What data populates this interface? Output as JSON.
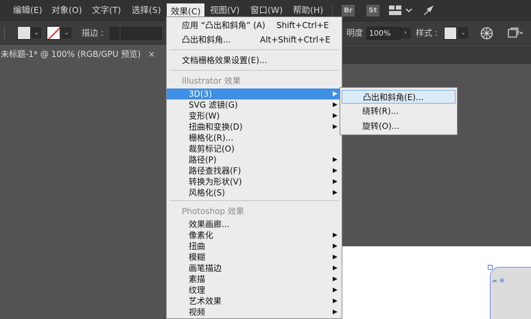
{
  "menubar": {
    "items": [
      "编辑(E)",
      "对象(O)",
      "文字(T)",
      "选择(S)",
      "效果(C)",
      "视图(V)",
      "窗口(W)",
      "帮助(H)"
    ],
    "br": "Br",
    "st": "St"
  },
  "controlbar": {
    "stroke_label": "描边 :",
    "opacity_label": "明度 :",
    "opacity_value": "100%",
    "style_label": "样式 :"
  },
  "document_tab": {
    "title": "未标题-1* @ 100% (RGB/GPU 预览)",
    "close": "×"
  },
  "effect_menu": {
    "top_items": [
      {
        "label": "应用 “凸出和斜角” (A)",
        "shortcut": "Shift+Ctrl+E"
      },
      {
        "label": "凸出和斜角...",
        "shortcut": "Alt+Shift+Ctrl+E"
      }
    ],
    "raster_settings": "文档栅格效果设置(E)...",
    "illustrator_header": "Illustrator 效果",
    "illustrator_items": [
      {
        "label": "3D(3)",
        "submenu": true
      },
      {
        "label": "SVG 滤镜(G)",
        "submenu": true
      },
      {
        "label": "变形(W)",
        "submenu": true
      },
      {
        "label": "扭曲和变换(D)",
        "submenu": true
      },
      {
        "label": "栅格化(R)...",
        "submenu": false
      },
      {
        "label": "裁剪标记(O)",
        "submenu": false
      },
      {
        "label": "路径(P)",
        "submenu": true
      },
      {
        "label": "路径查找器(F)",
        "submenu": true
      },
      {
        "label": "转换为形状(V)",
        "submenu": true
      },
      {
        "label": "风格化(S)",
        "submenu": true
      }
    ],
    "photoshop_header": "Photoshop 效果",
    "photoshop_items": [
      {
        "label": "效果画廊...",
        "submenu": false
      },
      {
        "label": "像素化",
        "submenu": true
      },
      {
        "label": "扭曲",
        "submenu": true
      },
      {
        "label": "模糊",
        "submenu": true
      },
      {
        "label": "画笔描边",
        "submenu": true
      },
      {
        "label": "素描",
        "submenu": true
      },
      {
        "label": "纹理",
        "submenu": true
      },
      {
        "label": "艺术效果",
        "submenu": true
      },
      {
        "label": "视频",
        "submenu": true
      }
    ],
    "submenu_arrow": "▶"
  },
  "submenu_3d": {
    "items": [
      "凸出和斜角(E)...",
      "绕转(R)...",
      "旋转(O)..."
    ]
  },
  "colors": {
    "highlight": "#3f8fe4",
    "menu_bg": "#ececec",
    "app_bg": "#535353"
  }
}
